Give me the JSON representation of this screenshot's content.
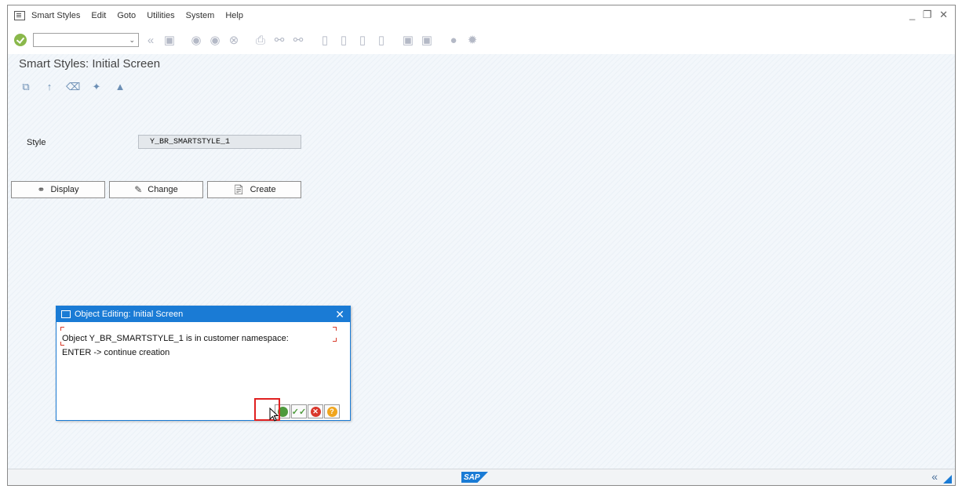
{
  "menu": {
    "items": [
      "Smart Styles",
      "Edit",
      "Goto",
      "Utilities",
      "System",
      "Help"
    ],
    "window_controls": "_ ❐ ✕"
  },
  "toolbar": {
    "command_value": "",
    "icons": [
      "enter-icon",
      "back-icon",
      "save-icon",
      "green-back-icon",
      "exit-icon",
      "cancel-icon",
      "print-icon",
      "find-icon",
      "find-next-icon",
      "first-page-icon",
      "prev-page-icon",
      "next-page-icon",
      "last-page-icon",
      "new-session-icon",
      "shortcut-icon",
      "help-icon",
      "settings-icon"
    ]
  },
  "page": {
    "title": "Smart Styles: Initial Screen"
  },
  "form": {
    "style_label": "Style",
    "style_value": "Y_BR_SMARTSTYLE_1"
  },
  "buttons": {
    "display": "Display",
    "change": "Change",
    "create": "Create"
  },
  "dialog": {
    "title": "Object Editing: Initial Screen",
    "line1": "Object Y_BR_SMARTSTYLE_1 is in customer namespace:",
    "line2": "ENTER -> continue creation"
  },
  "statusbar": {
    "logo": "SAP",
    "collapse_icon": "«"
  },
  "colors": {
    "accent": "#1a7bd5",
    "highlight": "#e02020",
    "ok_green": "#8ab84b"
  }
}
